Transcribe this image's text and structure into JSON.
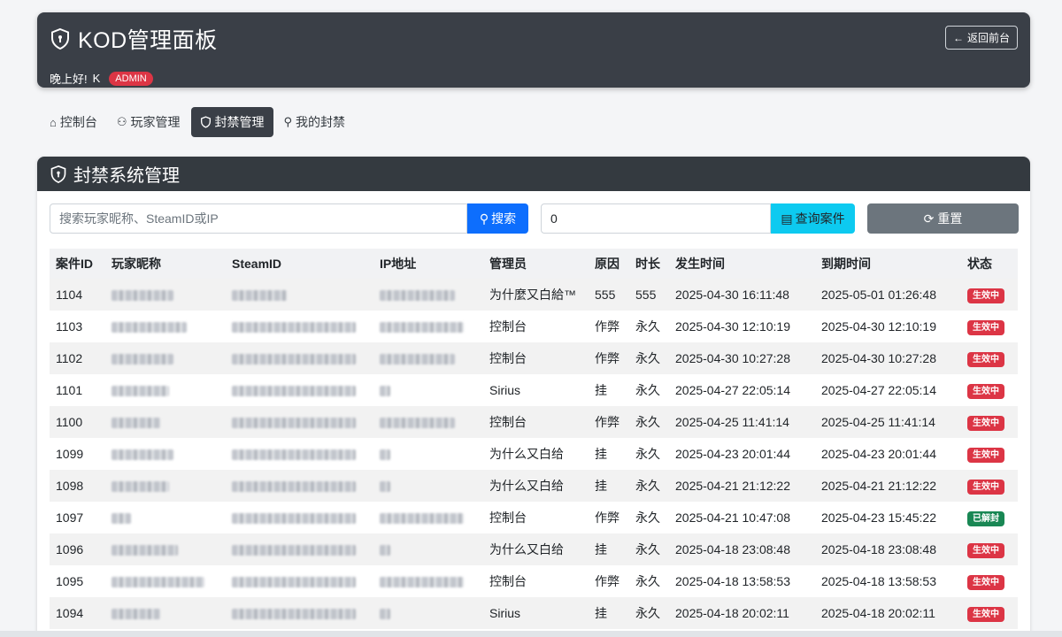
{
  "header": {
    "title": "KOD管理面板",
    "greeting": "晚上好!",
    "username": "K",
    "role_badge": "ADMIN",
    "back_button": "返回前台"
  },
  "tabs": [
    {
      "label": "控制台",
      "icon": "home-icon",
      "active": false
    },
    {
      "label": "玩家管理",
      "icon": "users-icon",
      "active": false
    },
    {
      "label": "封禁管理",
      "icon": "shield-icon",
      "active": true
    },
    {
      "label": "我的封禁",
      "icon": "user-lock-icon",
      "active": false
    }
  ],
  "card": {
    "title": "封禁系统管理",
    "search_placeholder": "搜索玩家昵称、SteamID或IP",
    "search_button": "搜索",
    "case_input_value": "0",
    "case_button": "查询案件",
    "reset_button": "重置"
  },
  "table": {
    "headers": [
      "案件ID",
      "玩家昵称",
      "SteamID",
      "IP地址",
      "管理员",
      "原因",
      "时长",
      "发生时间",
      "到期时间",
      "状态"
    ],
    "rows": [
      {
        "id": "1104",
        "admin": "为什麼又白給™",
        "reason": "555",
        "duration": "555",
        "time": "2025-04-30 16:11:48",
        "expire": "2025-05-01 01:26:48",
        "status": "生效中",
        "status_color": "red"
      },
      {
        "id": "1103",
        "admin": "控制台",
        "reason": "作弊",
        "duration": "永久",
        "time": "2025-04-30 12:10:19",
        "expire": "2025-04-30 12:10:19",
        "status": "生效中",
        "status_color": "red"
      },
      {
        "id": "1102",
        "admin": "控制台",
        "reason": "作弊",
        "duration": "永久",
        "time": "2025-04-30 10:27:28",
        "expire": "2025-04-30 10:27:28",
        "status": "生效中",
        "status_color": "red"
      },
      {
        "id": "1101",
        "admin": "Sirius",
        "reason": "挂",
        "duration": "永久",
        "time": "2025-04-27 22:05:14",
        "expire": "2025-04-27 22:05:14",
        "status": "生效中",
        "status_color": "red"
      },
      {
        "id": "1100",
        "admin": "控制台",
        "reason": "作弊",
        "duration": "永久",
        "time": "2025-04-25 11:41:14",
        "expire": "2025-04-25 11:41:14",
        "status": "生效中",
        "status_color": "red"
      },
      {
        "id": "1099",
        "admin": "为什么又白给",
        "reason": "挂",
        "duration": "永久",
        "time": "2025-04-23 20:01:44",
        "expire": "2025-04-23 20:01:44",
        "status": "生效中",
        "status_color": "red"
      },
      {
        "id": "1098",
        "admin": "为什么又白给",
        "reason": "挂",
        "duration": "永久",
        "time": "2025-04-21 21:12:22",
        "expire": "2025-04-21 21:12:22",
        "status": "生效中",
        "status_color": "red"
      },
      {
        "id": "1097",
        "admin": "控制台",
        "reason": "作弊",
        "duration": "永久",
        "time": "2025-04-21 10:47:08",
        "expire": "2025-04-23 15:45:22",
        "status": "已解封",
        "status_color": "green"
      },
      {
        "id": "1096",
        "admin": "为什么又白给",
        "reason": "挂",
        "duration": "永久",
        "time": "2025-04-18 23:08:48",
        "expire": "2025-04-18 23:08:48",
        "status": "生效中",
        "status_color": "red"
      },
      {
        "id": "1095",
        "admin": "控制台",
        "reason": "作弊",
        "duration": "永久",
        "time": "2025-04-18 13:58:53",
        "expire": "2025-04-18 13:58:53",
        "status": "生效中",
        "status_color": "red"
      },
      {
        "id": "1094",
        "admin": "Sirius",
        "reason": "挂",
        "duration": "永久",
        "time": "2025-04-18 20:02:11",
        "expire": "2025-04-18 20:02:11",
        "status": "生效中",
        "status_color": "red"
      }
    ]
  }
}
